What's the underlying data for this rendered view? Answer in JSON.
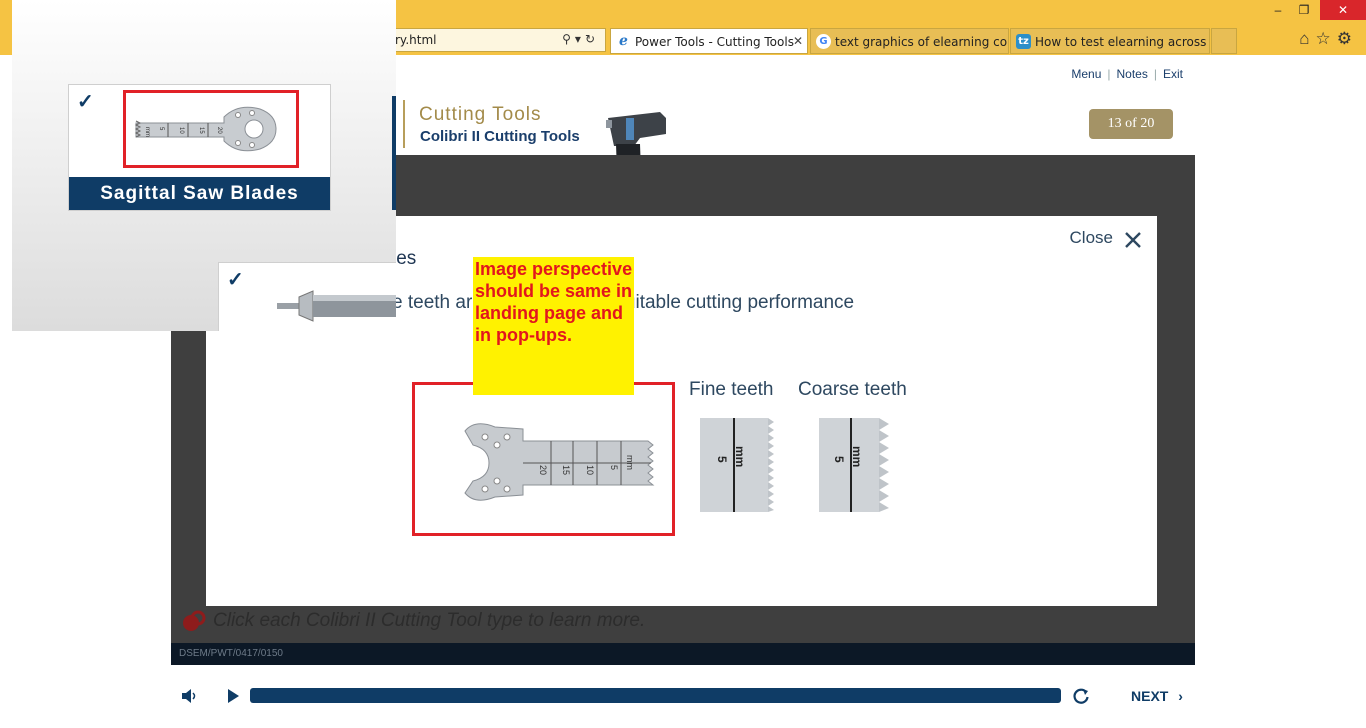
{
  "browser": {
    "address": "ry.html",
    "tabs": [
      {
        "label": "Power Tools - Cutting Tools",
        "icon": "ie-icon",
        "close": "✕"
      },
      {
        "label": "text graphics of elearning cour...",
        "icon": "google-icon"
      },
      {
        "label": "How to test elearning across m...",
        "icon": "tz-icon",
        "icon_text": "tz"
      }
    ],
    "win": {
      "minimize": "–",
      "restore": "❐",
      "close": "✕"
    }
  },
  "course": {
    "nav": {
      "menu": "Menu",
      "notes": "Notes",
      "exit": "Exit"
    },
    "title": "Cutting Tools",
    "subtitle": "Colibri II Cutting Tools",
    "page_counter": "13 of 20",
    "hint": "Click each Colibri II Cutting Tool type to learn more.",
    "footer_code": "DSEM/PWT/0417/0150"
  },
  "popup": {
    "close_label": "Close",
    "heading_fragment": "les",
    "desc_left": "e teeth ar",
    "desc_right": "h for a suitable cutting performance",
    "fine_label": "Fine teeth",
    "coarse_label": "Coarse teeth",
    "blade_numbers": [
      "20",
      "15",
      "10",
      "5",
      "mm"
    ],
    "sample_numbers": [
      "mm",
      "5"
    ]
  },
  "note": {
    "text": "Image perspective should be same in landing page and in pop-ups."
  },
  "inset": {
    "card1_label": "Sagittal Saw Blades",
    "check": "✓",
    "card1_numbers": [
      "mm",
      "5",
      "10",
      "15",
      "20"
    ]
  },
  "controls": {
    "next_label": "NEXT",
    "progress": 1.0
  },
  "colors": {
    "brand_blue": "#0f3c66",
    "gold": "#a49366",
    "annotation_red": "#e12127",
    "note_yellow": "#fff200"
  }
}
